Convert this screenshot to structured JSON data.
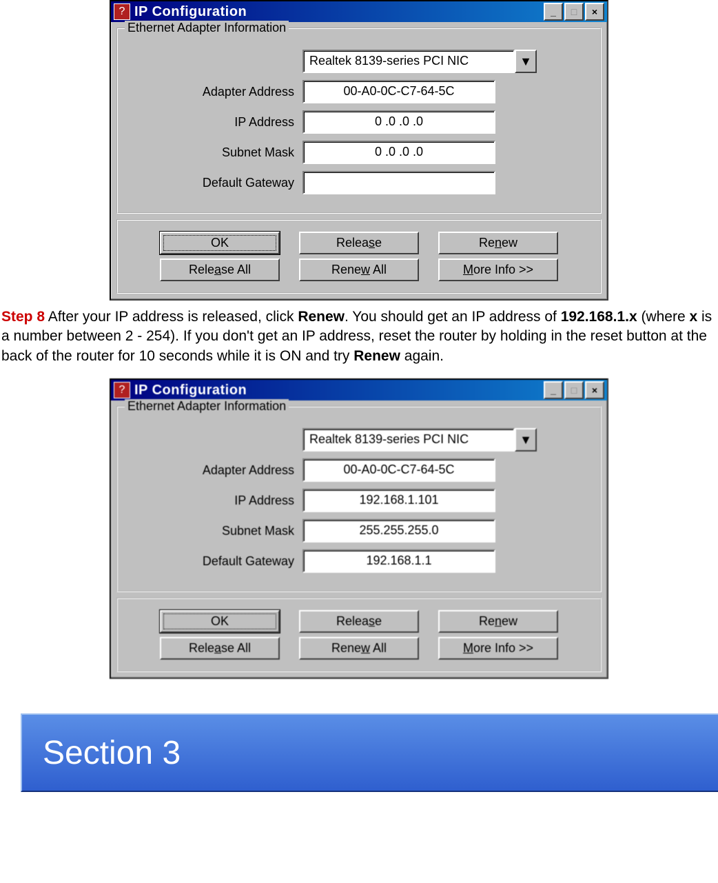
{
  "dialog1": {
    "title": "IP Configuration",
    "group_title": "Ethernet  Adapter Information",
    "adapter": "Realtek 8139-series PCI NIC",
    "labels": {
      "adapter_address": "Adapter Address",
      "ip_address": "IP Address",
      "subnet_mask": "Subnet Mask",
      "default_gateway": "Default Gateway"
    },
    "values": {
      "adapter_address": "00-A0-0C-C7-64-5C",
      "ip_address": "0 .0 .0 .0",
      "subnet_mask": "0 .0 .0 .0",
      "default_gateway": ""
    },
    "buttons": {
      "ok": "OK",
      "release": "Release",
      "renew": "Renew",
      "release_all": "Release All",
      "renew_all": "Renew All",
      "more_info": "More Info >>"
    }
  },
  "step8": {
    "label": "Step 8",
    "text_a": " After your IP address is released, click ",
    "bold_a": "Renew",
    "text_b": ". You should get an IP address of ",
    "bold_b": "192.168.1.x",
    "text_c": " (where ",
    "bold_c": "x",
    "text_d": " is a number between 2 - 254). If you don't get an IP address, reset the router by holding in the reset button at the back of the router for 10 seconds while it is ON and try ",
    "bold_d": "Renew",
    "text_e": " again."
  },
  "dialog2": {
    "title": "IP Configuration",
    "group_title": "Ethernet  Adapter Information",
    "adapter": "Realtek 8139-series PCI NIC",
    "labels": {
      "adapter_address": "Adapter Address",
      "ip_address": "IP Address",
      "subnet_mask": "Subnet Mask",
      "default_gateway": "Default Gateway"
    },
    "values": {
      "adapter_address": "00-A0-0C-C7-64-5C",
      "ip_address": "192.168.1.101",
      "subnet_mask": "255.255.255.0",
      "default_gateway": "192.168.1.1"
    },
    "buttons": {
      "ok": "OK",
      "release": "Release",
      "renew": "Renew",
      "release_all": "Release All",
      "renew_all": "Renew All",
      "more_info": "More Info >>"
    }
  },
  "section_banner": "Section 3"
}
